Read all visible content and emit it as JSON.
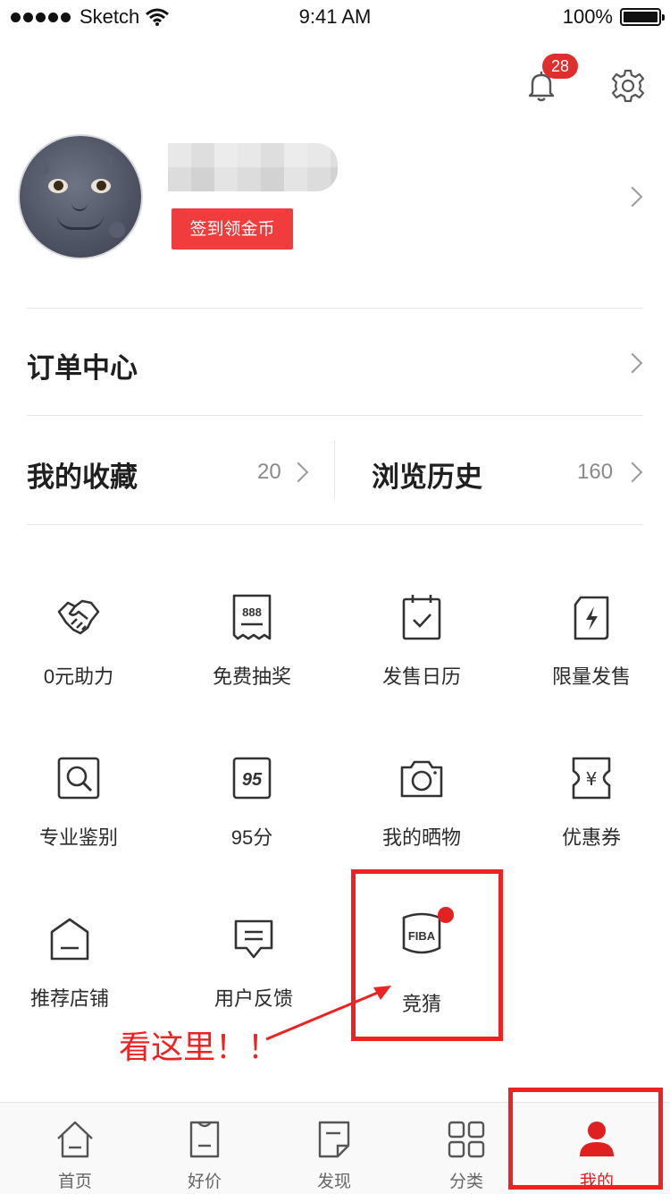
{
  "status_bar": {
    "carrier": "Sketch",
    "time": "9:41 AM",
    "battery": "100%"
  },
  "header": {
    "notification_count": "28"
  },
  "profile": {
    "checkin_label": "签到领金币"
  },
  "orders": {
    "title": "订单中心"
  },
  "favorites": {
    "title": "我的收藏",
    "count": "20"
  },
  "history": {
    "title": "浏览历史",
    "count": "160"
  },
  "grid": {
    "items": [
      {
        "label": "0元助力",
        "icon": "handshake-icon"
      },
      {
        "label": "免费抽奖",
        "icon": "lottery-ticket-icon"
      },
      {
        "label": "发售日历",
        "icon": "calendar-check-icon"
      },
      {
        "label": "限量发售",
        "icon": "lightning-card-icon"
      },
      {
        "label": "专业鉴别",
        "icon": "magnifier-icon"
      },
      {
        "label": "95分",
        "icon": "score-95-icon"
      },
      {
        "label": "我的晒物",
        "icon": "camera-icon"
      },
      {
        "label": "优惠券",
        "icon": "coupon-yen-icon"
      },
      {
        "label": "推荐店铺",
        "icon": "shop-icon"
      },
      {
        "label": "用户反馈",
        "icon": "feedback-icon"
      },
      {
        "label": "竞猜",
        "icon": "fiba-shield-icon"
      }
    ],
    "fiba_text": "FIBA"
  },
  "annotation": "看这里！！",
  "tabbar": {
    "tabs": [
      {
        "label": "首页",
        "icon": "home-icon"
      },
      {
        "label": "好价",
        "icon": "deal-ticket-icon"
      },
      {
        "label": "发现",
        "icon": "discover-note-icon"
      },
      {
        "label": "分类",
        "icon": "category-grid-icon"
      },
      {
        "label": "我的",
        "icon": "user-icon",
        "active": true
      }
    ]
  },
  "colors": {
    "accent": "#e02020",
    "badge": "#e02d2d",
    "checkin": "#f03c3c",
    "annotation": "#ee2222"
  }
}
